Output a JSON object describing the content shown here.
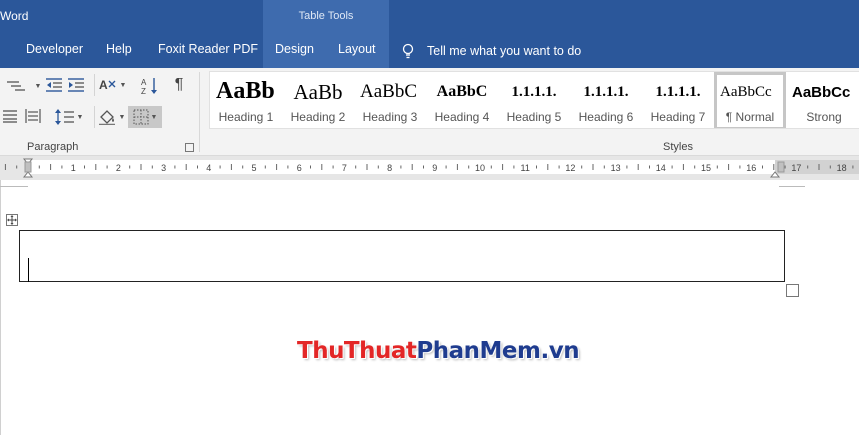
{
  "app": {
    "title": "Word"
  },
  "contextual_tab_group": {
    "label": "Table Tools"
  },
  "tabs": [
    {
      "label": "Developer"
    },
    {
      "label": "Help"
    },
    {
      "label": "Foxit Reader PDF"
    },
    {
      "label": "Design"
    },
    {
      "label": "Layout"
    }
  ],
  "tell_me": {
    "label": "Tell me what you want to do"
  },
  "ribbon": {
    "paragraph_group_label": "Paragraph",
    "styles_group_label": "Styles",
    "paragraph_mark_glyph": "¶",
    "styles": [
      {
        "sample": "AaBb",
        "name": "Heading 1"
      },
      {
        "sample": "AaBb",
        "name": "Heading 2"
      },
      {
        "sample": "AaBbC",
        "name": "Heading 3"
      },
      {
        "sample": "AaBbC",
        "name": "Heading 4"
      },
      {
        "sample": "1.1.1.1.",
        "name": "Heading 5"
      },
      {
        "sample": "1.1.1.1.",
        "name": "Heading 6"
      },
      {
        "sample": "1.1.1.1.",
        "name": "Heading 7"
      },
      {
        "sample": "AaBbCc",
        "name": "¶ Normal",
        "selected": true
      },
      {
        "sample": "AaBbCc",
        "name": "Strong"
      }
    ]
  },
  "ruler": {
    "labels_left": [
      "1"
    ],
    "labels_right": [
      "1",
      "2",
      "3",
      "4",
      "5",
      "6",
      "7",
      "8",
      "9",
      "10",
      "11",
      "12",
      "13",
      "14",
      "15",
      "16",
      "17",
      "18"
    ]
  },
  "watermark": {
    "part1": "ThuThuat",
    "part2": "PhanMem",
    "part3": ".vn"
  },
  "colors": {
    "ribbon_blue": "#2b579a",
    "contextual_band": "#3e6bae",
    "watermark_red": "#e32626",
    "watermark_navy": "#1f3c8f"
  }
}
